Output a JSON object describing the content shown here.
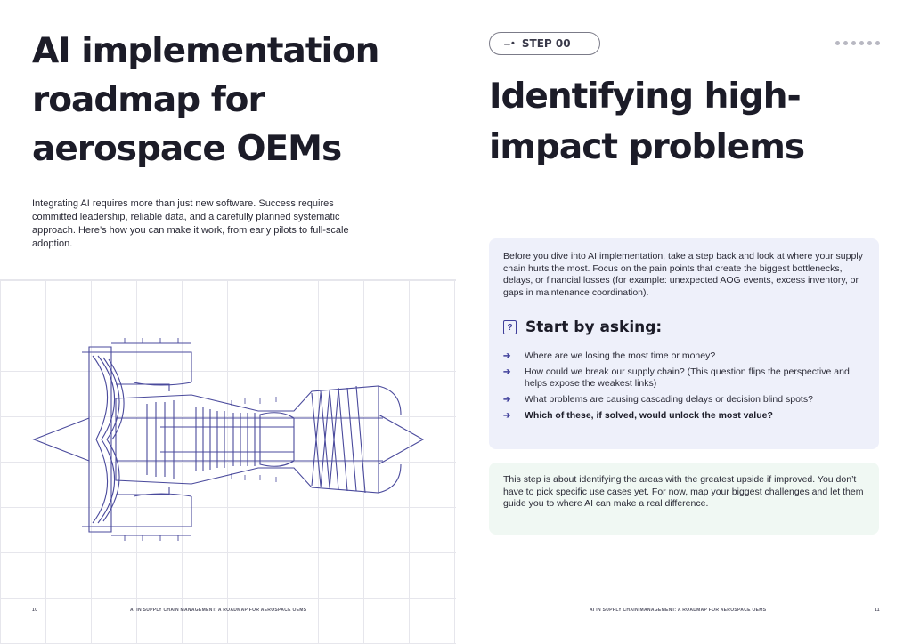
{
  "left_page": {
    "title": "AI implementation roadmap for aerospace OEMs",
    "intro": "Integrating AI requires more than just new software. Success requires committed leadership, reliable data, and a carefully  planned systematic approach. Here’s how you can make it work, from early pilots to full-scale adoption.",
    "page_number": "10",
    "footer": "AI IN SUPPLY CHAIN MANAGEMENT: A ROADMAP FOR AEROSPACE OEMS",
    "illustration_icon": "turbofan-engine-icon"
  },
  "right_page": {
    "step_badge": {
      "arrow": "→•",
      "label": "STEP 00"
    },
    "title": "Identifying high-impact problems",
    "intro_card": {
      "text": "Before you dive into AI implementation, take a step back and look at where your supply chain hurts the most. Focus on the pain points that create the biggest bottlenecks, delays, or financial losses (for example: unexpected AOG events, excess inventory, or gaps in maintenance coordination).",
      "heading": "Start by asking:",
      "heading_icon": "question-bubble-icon",
      "questions": [
        "Where are we losing the most time or money?",
        "How could we break our supply chain? (This question flips the perspective and helps expose the weakest links)",
        "What problems are causing cascading delays or decision blind spots?",
        "Which of these, if solved, would unlock the most value?"
      ]
    },
    "note_card": {
      "text": "This step is about identifying the areas with the greatest upside if improved. You don’t have to pick specific use cases yet. For now, map your biggest challenges and let them guide you to where AI can make a real difference."
    },
    "footer": "AI IN SUPPLY CHAIN MANAGEMENT: A ROADMAP FOR AEROSPACE OEMS",
    "page_number": "11"
  },
  "colors": {
    "accent": "#3f3f9a",
    "engine_stroke": "#4a4a9c",
    "blue_card": "#eef0fa",
    "green_card": "#f0f8f3"
  }
}
